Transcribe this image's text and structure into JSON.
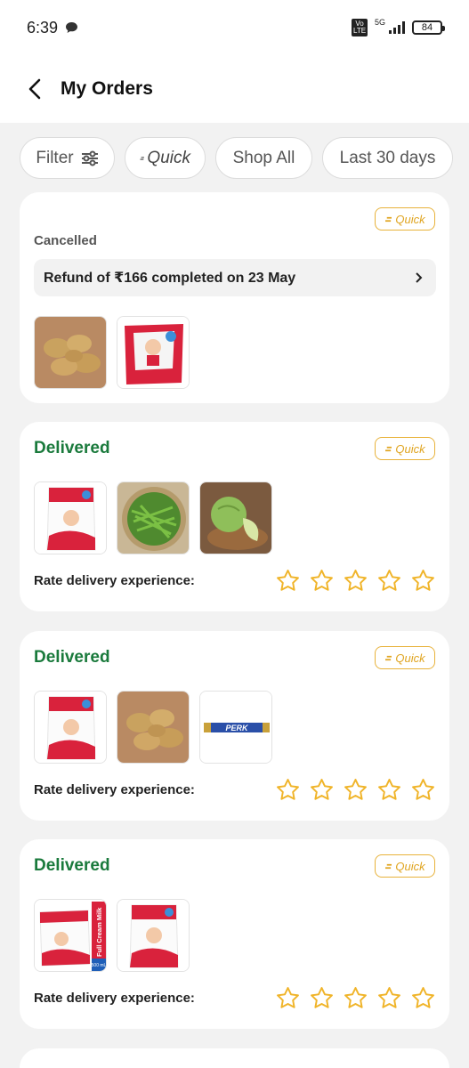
{
  "status_bar": {
    "time": "6:39",
    "network": "5G",
    "volte": "Vo LTE",
    "battery": "84"
  },
  "header": {
    "title": "My Orders"
  },
  "filters": {
    "filter_label": "Filter",
    "quick_label": "Quick",
    "shop_all_label": "Shop All",
    "date_label": "Last 30 days"
  },
  "orders": [
    {
      "badge": "Quick",
      "status": "Cancelled",
      "refund_text": "Refund of ₹166 completed on 23 May",
      "items": [
        "potatoes",
        "milk-packet"
      ]
    },
    {
      "badge": "Quick",
      "status": "Delivered",
      "rate_label": "Rate delivery experience:",
      "items": [
        "milk-packet",
        "green-beans",
        "cabbage"
      ]
    },
    {
      "badge": "Quick",
      "status": "Delivered",
      "rate_label": "Rate delivery experience:",
      "items": [
        "milk-packet",
        "potatoes",
        "perk-chocolate"
      ]
    },
    {
      "badge": "Quick",
      "status": "Delivered",
      "rate_label": "Rate delivery experience:",
      "items": [
        "full-cream-milk-packet",
        "milk-packet"
      ]
    }
  ],
  "product_text": {
    "perk": "PERK",
    "full_cream": "Full Cream Milk",
    "size": "500 mL"
  },
  "colors": {
    "delivered": "#1a7a3c",
    "quick_badge": "#e0a521",
    "star": "#f0b429"
  }
}
